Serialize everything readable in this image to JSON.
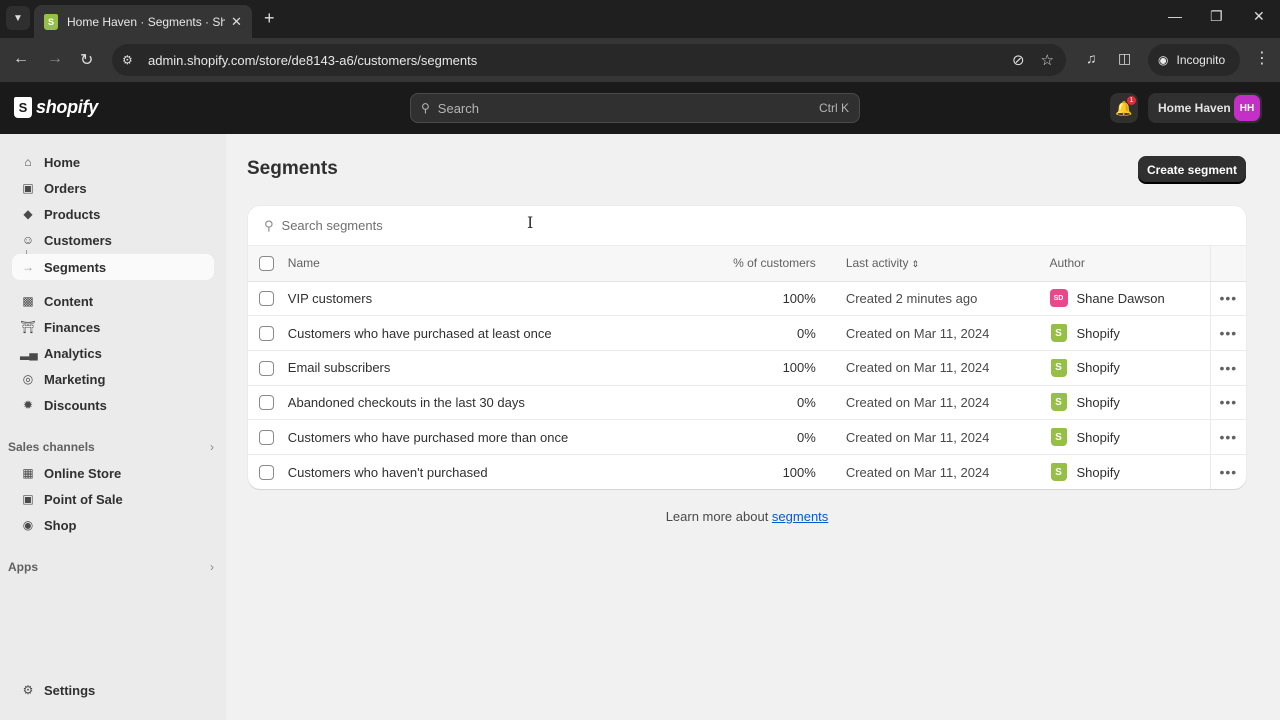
{
  "browser": {
    "tab_title": "Home Haven · Segments · Shopify",
    "url": "admin.shopify.com/store/de8143-a6/customers/segments",
    "profile_label": "Incognito"
  },
  "topbar": {
    "brand": "shopify",
    "search_placeholder": "Search",
    "search_shortcut": "Ctrl K",
    "notification_count": "1",
    "store_name": "Home Haven",
    "store_initials": "HH"
  },
  "sidebar": {
    "items": [
      {
        "label": "Home",
        "icon": "home-icon"
      },
      {
        "label": "Orders",
        "icon": "inbox-icon"
      },
      {
        "label": "Products",
        "icon": "tag-icon"
      },
      {
        "label": "Customers",
        "icon": "person-icon"
      },
      {
        "label": "Segments",
        "icon": "",
        "active": true
      },
      {
        "label": "Content",
        "icon": "content-icon"
      },
      {
        "label": "Finances",
        "icon": "bank-icon"
      },
      {
        "label": "Analytics",
        "icon": "bar-chart-icon"
      },
      {
        "label": "Marketing",
        "icon": "target-icon"
      },
      {
        "label": "Discounts",
        "icon": "discount-icon"
      }
    ],
    "sales_channels_title": "Sales channels",
    "sales_channels": [
      {
        "label": "Online Store",
        "icon": "store-icon"
      },
      {
        "label": "Point of Sale",
        "icon": "pos-icon"
      },
      {
        "label": "Shop",
        "icon": "shop-icon"
      }
    ],
    "apps_title": "Apps",
    "settings_label": "Settings"
  },
  "page": {
    "title": "Segments",
    "create_button": "Create segment",
    "search_placeholder": "Search segments",
    "columns": {
      "name": "Name",
      "pct": "% of customers",
      "activity": "Last activity",
      "author": "Author"
    },
    "rows": [
      {
        "name": "VIP customers",
        "pct": "100%",
        "activity": "Created 2 minutes ago",
        "author": "Shane Dawson",
        "author_initials": "SD",
        "author_type": "user"
      },
      {
        "name": "Customers who have purchased at least once",
        "pct": "0%",
        "activity": "Created on Mar 11, 2024",
        "author": "Shopify",
        "author_type": "shopify"
      },
      {
        "name": "Email subscribers",
        "pct": "100%",
        "activity": "Created on Mar 11, 2024",
        "author": "Shopify",
        "author_type": "shopify"
      },
      {
        "name": "Abandoned checkouts in the last 30 days",
        "pct": "0%",
        "activity": "Created on Mar 11, 2024",
        "author": "Shopify",
        "author_type": "shopify"
      },
      {
        "name": "Customers who have purchased more than once",
        "pct": "0%",
        "activity": "Created on Mar 11, 2024",
        "author": "Shopify",
        "author_type": "shopify"
      },
      {
        "name": "Customers who haven't purchased",
        "pct": "100%",
        "activity": "Created on Mar 11, 2024",
        "author": "Shopify",
        "author_type": "shopify"
      }
    ],
    "learn_more_prefix": "Learn more about ",
    "learn_more_link": "segments"
  },
  "colors": {
    "brand_green": "#95bf47",
    "store_avatar": "#c42fc8",
    "user_avatar": "#e8498a",
    "link": "#005bd3"
  }
}
